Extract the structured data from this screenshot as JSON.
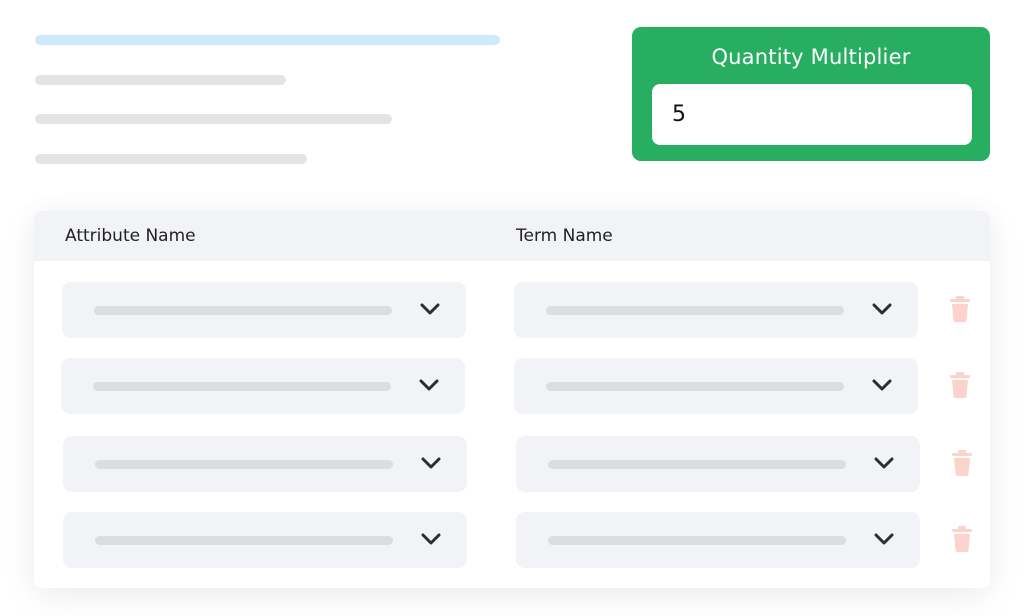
{
  "quantity_multiplier": {
    "title": "Quantity Multiplier",
    "value": "5"
  },
  "table": {
    "columns": [
      "Attribute Name",
      "Term Name"
    ],
    "rows": [
      {
        "attribute_value": "",
        "term_value": ""
      },
      {
        "attribute_value": "",
        "term_value": ""
      },
      {
        "attribute_value": "",
        "term_value": ""
      },
      {
        "attribute_value": "",
        "term_value": ""
      }
    ]
  },
  "icons": {
    "chevron": "chevron-down-icon",
    "delete": "trash-icon"
  },
  "colors": {
    "accent_green": "#28ae60",
    "skeleton_blue": "#cde9fa",
    "skeleton_gray": "#e3e4e6",
    "trash_pink": "#fbd3cc",
    "field_bg": "#f2f3f6"
  }
}
